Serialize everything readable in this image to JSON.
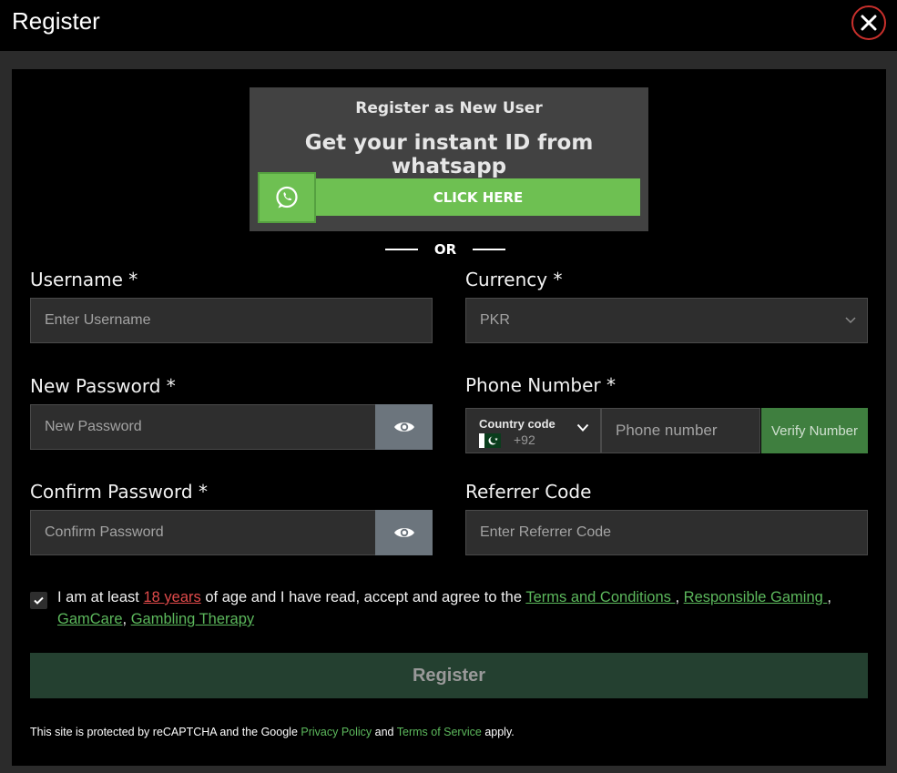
{
  "window": {
    "title": "Register"
  },
  "whatsapp": {
    "subtitle": "Register as New User",
    "headline": "Get your instant ID from whatsapp",
    "button_label": "CLICK HERE"
  },
  "divider": {
    "text": "OR"
  },
  "form": {
    "username": {
      "label": "Username *",
      "placeholder": "Enter Username"
    },
    "currency": {
      "label": "Currency *",
      "selected": "PKR"
    },
    "new_password": {
      "label": "New Password *",
      "placeholder": "New Password"
    },
    "phone": {
      "label": "Phone Number *",
      "country_code_label": "Country code",
      "country_code_value": "+92",
      "placeholder": "Phone number",
      "verify_label": "Verify Number"
    },
    "confirm_password": {
      "label": "Confirm Password *",
      "placeholder": "Confirm Password"
    },
    "referrer": {
      "label": "Referrer Code",
      "placeholder": "Enter Referrer Code"
    }
  },
  "agreement": {
    "checked": true,
    "prefix": "I am at least ",
    "age_link": "18 years",
    "middle": " of age and I have read, accept and agree to the ",
    "terms_link": "Terms and Conditions ",
    "sep1": ", ",
    "responsible_link": "Responsible Gaming ",
    "sep2": ", ",
    "gamcare_link": "GamCare",
    "sep3": ", ",
    "therapy_link": "Gambling Therapy"
  },
  "submit": {
    "label": "Register"
  },
  "recaptcha": {
    "prefix": "This site is protected by reCAPTCHA and the Google ",
    "privacy_link": "Privacy Policy",
    "and": " and ",
    "tos_link": "Terms of Service",
    "suffix": " apply."
  },
  "colors": {
    "accent_green": "#6ec052",
    "link_green": "#5cb85c",
    "age_red": "#e04a4a",
    "close_red": "#c9302c",
    "register_button": "#244030"
  }
}
